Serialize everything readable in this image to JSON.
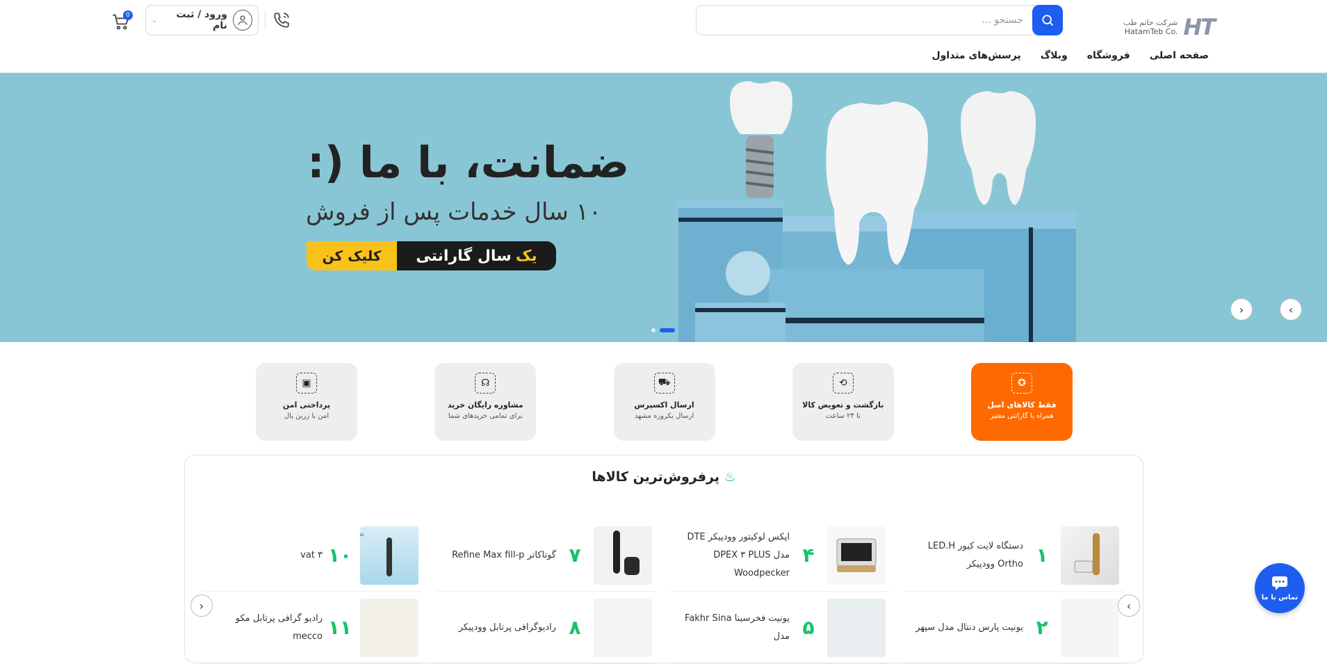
{
  "header": {
    "logo_mark": "HT",
    "logo_fa": "شرکت حاتم طب",
    "logo_en": "HatamTeb Co.",
    "search_placeholder": "جستجو ...",
    "login_label": "ورود / ثبت نام",
    "cart_count": "0"
  },
  "nav": {
    "items": [
      "صفحه اصلی",
      "فروشگاه",
      "وبلاگ",
      "پرسش‌های متداول"
    ]
  },
  "hero": {
    "headline": "ضمانت، با ما (:",
    "subheadline": "۱۰ سال خدمات پس از فروش",
    "cta_dark_1": "یک",
    "cta_dark_2": "سال گارانتی",
    "cta_yellow": "کلیک کن",
    "bg_color": "#89c6d5"
  },
  "features": [
    {
      "icon": "badge-icon",
      "title": "فقط کالاهای اصل",
      "sub": "همراه با گارانتی معتبر",
      "highlight": true
    },
    {
      "icon": "return-icon",
      "title": "بازگشت و تعویض کالا",
      "sub": "تا ۲۴ ساعت",
      "highlight": false
    },
    {
      "icon": "car-icon",
      "title": "ارسال اکسپرس",
      "sub": "ارسال یکروزه مشهد",
      "highlight": false
    },
    {
      "icon": "headset-icon",
      "title": "مشاوره رایگان خرید",
      "sub": "برای تمامی خریدهای شما",
      "highlight": false
    },
    {
      "icon": "wallet-icon",
      "title": "پرداختی امن",
      "sub": "امن با زرین پال",
      "highlight": false
    }
  ],
  "bestsellers": {
    "title": "پرفروش‌ترین کالاها",
    "items": [
      {
        "rank": "۱",
        "name": "دستگاه لایت کیور LED.H Ortho وودپیکر"
      },
      {
        "rank": "۴",
        "name": "اپکس لوکیتور وودپیکر DTE مدل DPEX ۳ PLUS Woodpecker"
      },
      {
        "rank": "۷",
        "name": "گوتاکاتر Refine Max fill-p"
      },
      {
        "rank": "۱۰",
        "name": "vat ۳"
      },
      {
        "rank": "۲",
        "name": "یونیت پارس دنتال مدل سپهر"
      },
      {
        "rank": "۵",
        "name": "یونیت فخرسینا Fakhr Sina مدل"
      },
      {
        "rank": "۸",
        "name": "رادیوگرافی پرتابل وودپیکر"
      },
      {
        "rank": "۱۱",
        "name": "رادیو گرافی پرتابل مکو mecco"
      }
    ]
  },
  "contact_label": "تماس با ما",
  "colors": {
    "accent": "#1d5ef1",
    "orange": "#ff6a00",
    "green": "#19c26b"
  }
}
